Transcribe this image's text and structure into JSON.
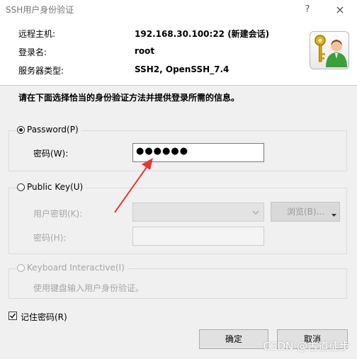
{
  "window": {
    "title": "SSH用户身份验证",
    "help_glyph": "?",
    "close_glyph": "×"
  },
  "connection": {
    "remote_host_label": "远程主机:",
    "remote_host_value": "192.168.30.100:22 (新建会话)",
    "login_label": "登录名:",
    "login_value": "root",
    "server_type_label": "服务器类型:",
    "server_type_value": "SSH2, OpenSSH_7.4"
  },
  "instruction": "请在下面选择恰当的身份验证方法并提供登录所需的信息。",
  "password_group": {
    "radio_label": "Password(P)",
    "selected": true,
    "field_label": "密码(W):",
    "field_value": "●●●●●●"
  },
  "publickey_group": {
    "radio_label": "Public Key(U)",
    "user_key_label": "用户密钥(K):",
    "passphrase_label": "密码(H):",
    "browse_label": "浏览(B)..."
  },
  "keyboard_group": {
    "radio_label": "Keyboard Interactive(I)",
    "description": "使用键盘输入用户身份验证。"
  },
  "remember_password": {
    "label": "记住密码(R)",
    "checked": true
  },
  "buttons": {
    "ok": "确定",
    "cancel": "取消"
  },
  "watermark": "CSDN @古道徒步",
  "colors": {
    "annotation_arrow": "#e53935"
  },
  "icons": {
    "user_key": "key-user-icon"
  }
}
